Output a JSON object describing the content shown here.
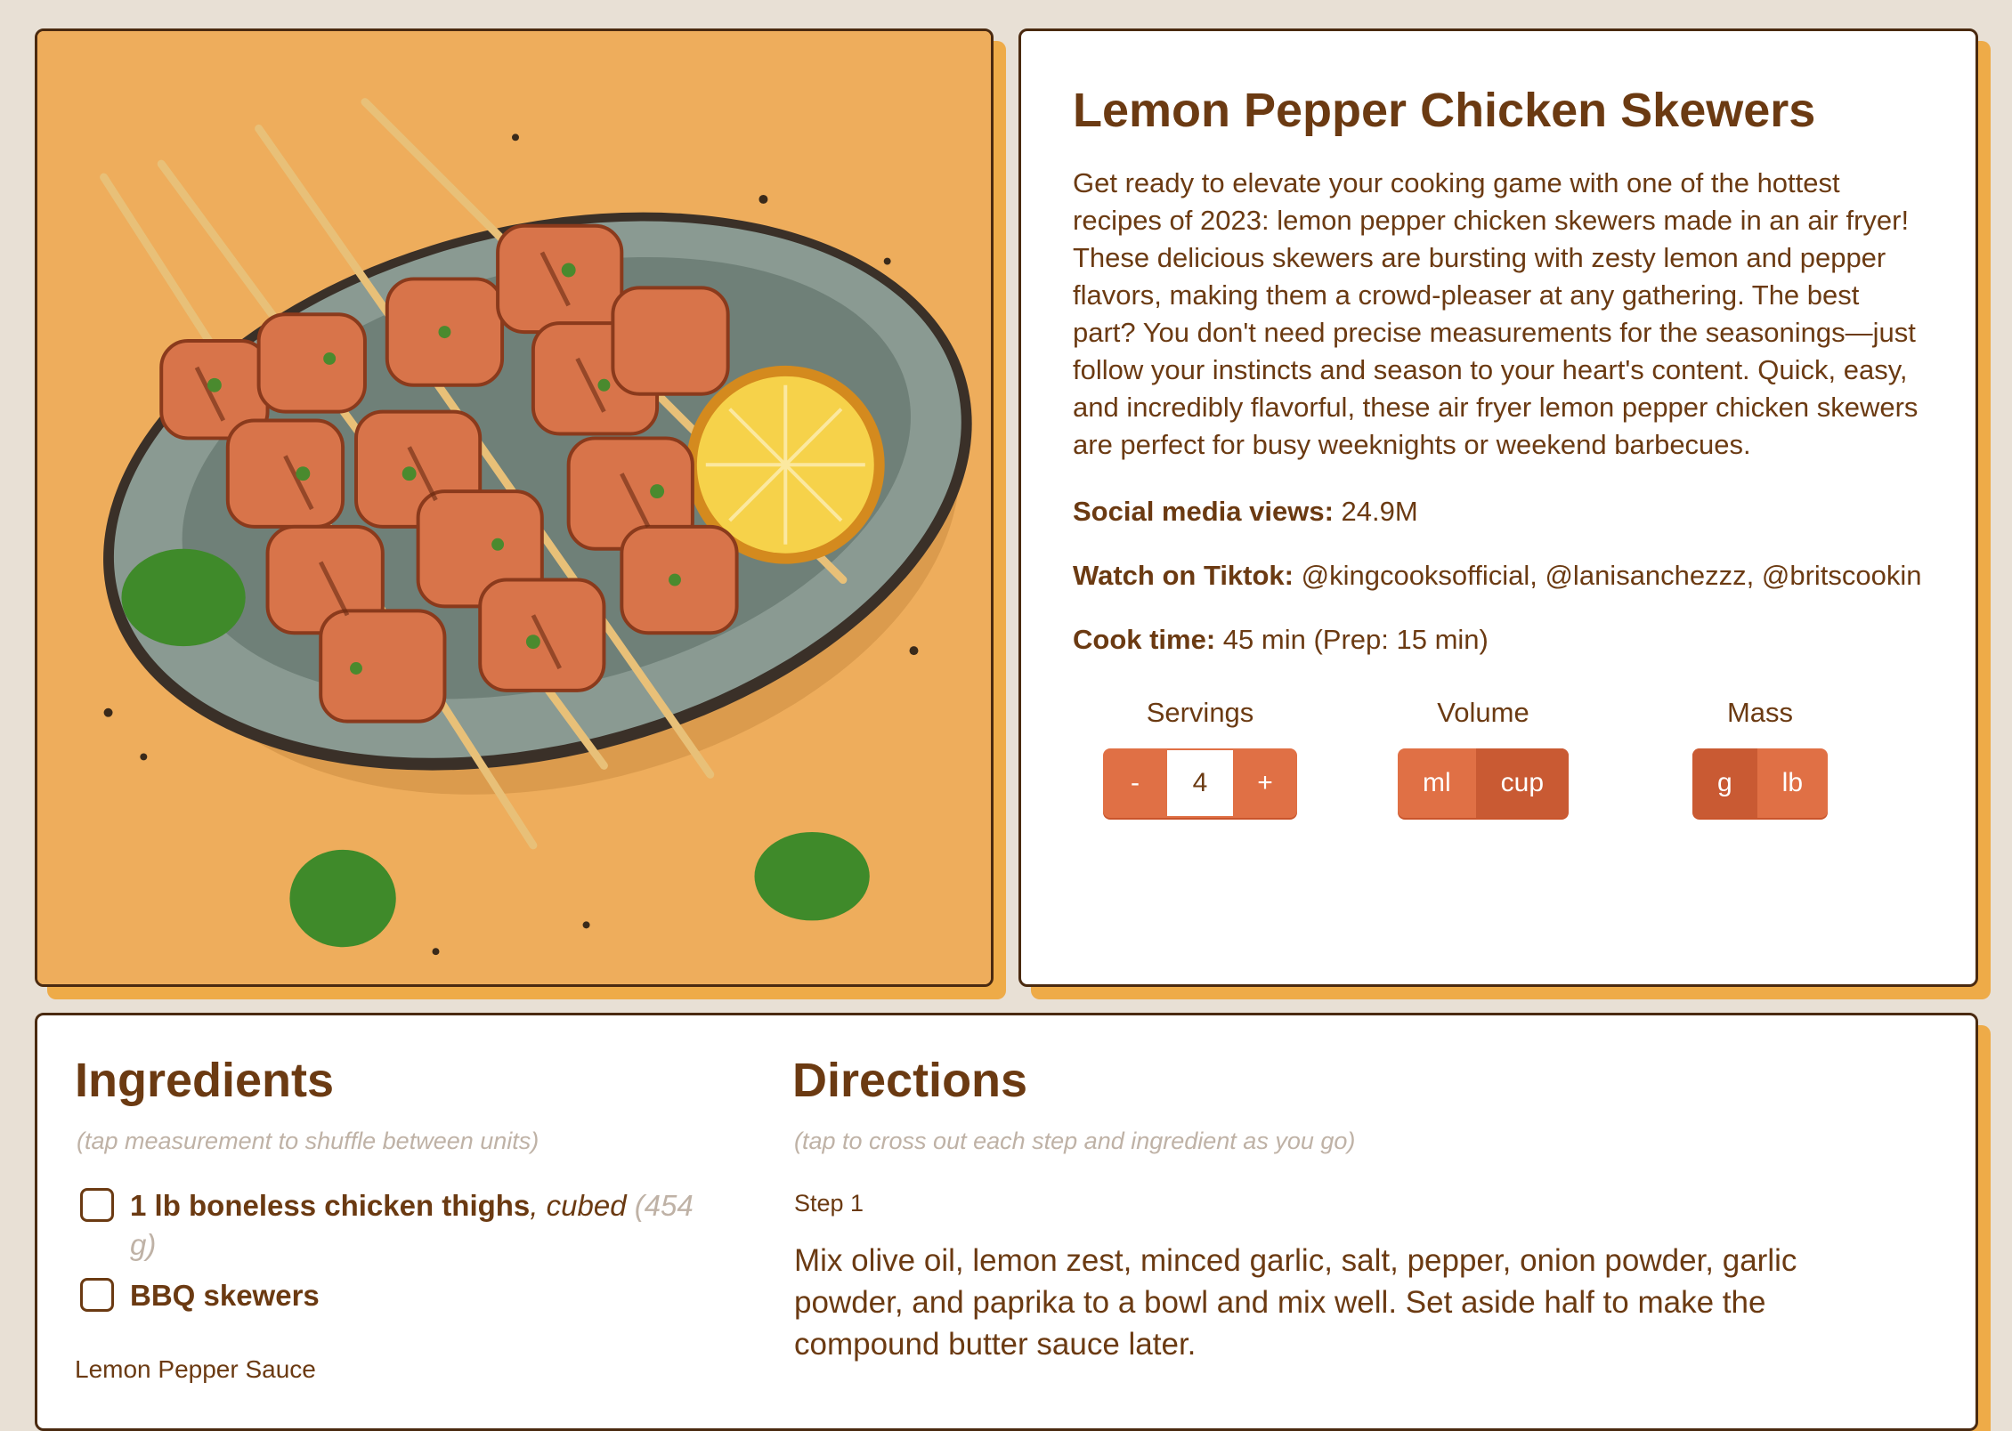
{
  "recipe": {
    "title": "Lemon Pepper Chicken Skewers",
    "description": "Get ready to elevate your cooking game with one of the hottest recipes of 2023: lemon pepper chicken skewers made in an air fryer! These delicious skewers are bursting with zesty lemon and pepper flavors, making them a crowd-pleaser at any gathering. The best part? You don't need precise measurements for the seasonings—just follow your instincts and season to your heart's content. Quick, easy, and incredibly flavorful, these air fryer lemon pepper chicken skewers are perfect for busy weeknights or weekend barbecues.",
    "views_label": "Social media views:",
    "views_value": " 24.9M",
    "tiktok_label": "Watch on Tiktok:",
    "tiktok_value": " @kingcooksofficial, @lanisanchezzz, @britscookin",
    "cook_label": "Cook time:",
    "cook_value": " 45 min (Prep: 15 min)"
  },
  "controls": {
    "servings_label": "Servings",
    "minus": "-",
    "servings_value": "4",
    "plus": "+",
    "volume_label": "Volume",
    "volume_options": [
      "ml",
      "cup"
    ],
    "volume_selected": "cup",
    "mass_label": "Mass",
    "mass_options": [
      "g",
      "lb"
    ],
    "mass_selected": "g"
  },
  "ingredients": {
    "heading": "Ingredients",
    "hint": "(tap measurement to shuffle between units)",
    "items": [
      {
        "name": "1 lb boneless chicken thighs",
        "note": ", cubed",
        "alt": " (454 g)"
      },
      {
        "name": "BBQ skewers",
        "note": "",
        "alt": ""
      }
    ],
    "subheading": "Lemon Pepper Sauce"
  },
  "directions": {
    "heading": "Directions",
    "hint": "(tap to cross out each step and ingredient as you go)",
    "step_label": "Step 1",
    "step_text": "Mix olive oil, lemon zest, minced garlic, salt, pepper, onion powder, garlic powder, and paprika to a bowl and mix well. Set aside half to make the compound butter sauce later."
  },
  "colors": {
    "accent": "#e07045",
    "shadow": "#eeab48",
    "text": "#6b3a12",
    "background": "#e8e0d5"
  }
}
